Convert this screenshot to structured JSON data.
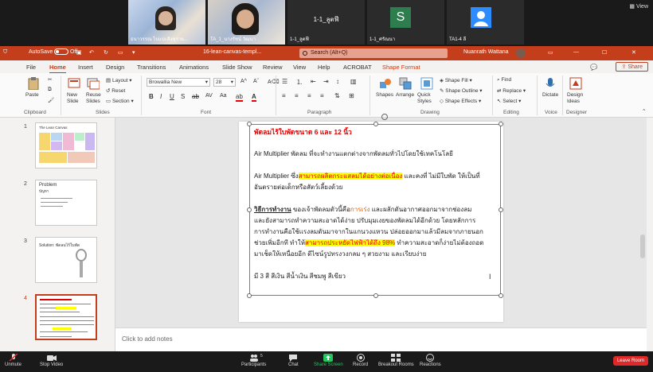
{
  "gallery": {
    "tiles": [
      {
        "name": "ธนาวรรณ ไบแปะสิงขุราย..."
      },
      {
        "name": "TA_1_นางรัชน์ วัฒนา"
      },
      {
        "name": "1-1_ลูตฟี",
        "center": "1-1_ลูตฟี"
      },
      {
        "name": "1-1_ศรัณนา",
        "avatar": "S"
      },
      {
        "name": "TA1-4 ลี"
      }
    ],
    "view_label": "View"
  },
  "ppt": {
    "autosave_label": "AutoSave",
    "autosave_state": "Off",
    "doc_title": "16-lean-canvas-templ...",
    "search_placeholder": "Search (Alt+Q)",
    "user_name": "Nuanrath Wattana",
    "tabs": [
      "File",
      "Home",
      "Insert",
      "Design",
      "Transitions",
      "Animations",
      "Slide Show",
      "Review",
      "View",
      "Help",
      "ACROBAT",
      "Shape Format"
    ],
    "share_label": "Share",
    "ribbon": {
      "paste": "Paste",
      "new_slide": "New Slide",
      "reuse_slides": "Reuse Slides",
      "layout": "Layout",
      "reset": "Reset",
      "section": "Section",
      "font_name": "Browallia New",
      "font_size": "28",
      "shapes": "Shapes",
      "arrange": "Arrange",
      "quick_styles": "Quick Styles",
      "shape_fill": "Shape Fill",
      "shape_outline": "Shape Outline",
      "shape_effects": "Shape Effects",
      "find": "Find",
      "replace": "Replace",
      "select": "Select",
      "dictate": "Dictate",
      "design_ideas": "Design Ideas",
      "groups": [
        "Clipboard",
        "Slides",
        "Font",
        "Paragraph",
        "Drawing",
        "Editing",
        "Voice",
        "Designer"
      ]
    },
    "thumbnails": [
      {
        "num": "1",
        "title": "The Lean Canvas"
      },
      {
        "num": "2",
        "title": "Problem",
        "sub": "ปัญหา"
      },
      {
        "num": "3",
        "title": "Solution: พัดลมไร้ใบพัด"
      },
      {
        "num": "4",
        "title": ""
      }
    ],
    "slide": {
      "heading": "พัดลมไร้ใบพัดขนาด 6 และ 12 นิ้ว",
      "line1": "Air Multiplier พัดลม ที่จะทำงานแตกต่างจากพัดลมทั่วไปโดยใช้เทคโนโลยี",
      "line2a": "Air Multiplier ซึ่ง",
      "line2b": "สามารถผลิตกระแสลมได้อย่างต่อเนื่อง",
      "line2c": " และคงที่ ไม่มีใบพัด ให้เป็นที่",
      "line3": "อันตรายต่อเด็กหรือสัตว์เลี้ยงด้วย",
      "line4a": "วิธีการทำงาน",
      "line4b": " ของเจ้าพัดลมตัวนี้คือ",
      "line4c": "การเร่ง",
      "line4d": " และผลักดันอากาศออกมาจากช่องลม",
      "line5": "และยังสามารถทำความสะอาดได้ง่าย ปรับมุมเงยของพัดลมได้อีกด้วย โดยหลักการ",
      "line6": "การทำงานคือใช้แรงลมดันมาจากในแกนวงแหวน ปล่อยออกมาแล้วมีลมจากภายนอก",
      "line7a": "ช่วยเพิ่มอีกที ทำให้",
      "line7b": "สามารถประหยัดไฟฟ้าได้ถึง 98%",
      "line7c": " ทำความสะอาดก็ง่ายไม่ต้องถอด",
      "line8": "มาเช็ดให้เหนื่อยอีก ดีไซน์รูปทรงวงกลม ๆ สวยงาม และเรียบง่าย",
      "line9": "มี 3 สี สีเงิน สีน้ำเงิน สีชมพู สีเขียว"
    },
    "notes_placeholder": "Click to add notes"
  },
  "zoom": {
    "controls": [
      {
        "label": "Unmute"
      },
      {
        "label": "Stop Video"
      },
      {
        "label": "Participants",
        "badge": "5"
      },
      {
        "label": "Chat"
      },
      {
        "label": "Share Screen"
      },
      {
        "label": "Record"
      },
      {
        "label": "Breakout Rooms"
      },
      {
        "label": "Reactions"
      }
    ],
    "leave_label": "Leave Room"
  },
  "colors": {
    "accent": "#c43e1c",
    "highlight": "#ffff00",
    "text_red": "#e00000",
    "share_green": "#22c55e"
  }
}
